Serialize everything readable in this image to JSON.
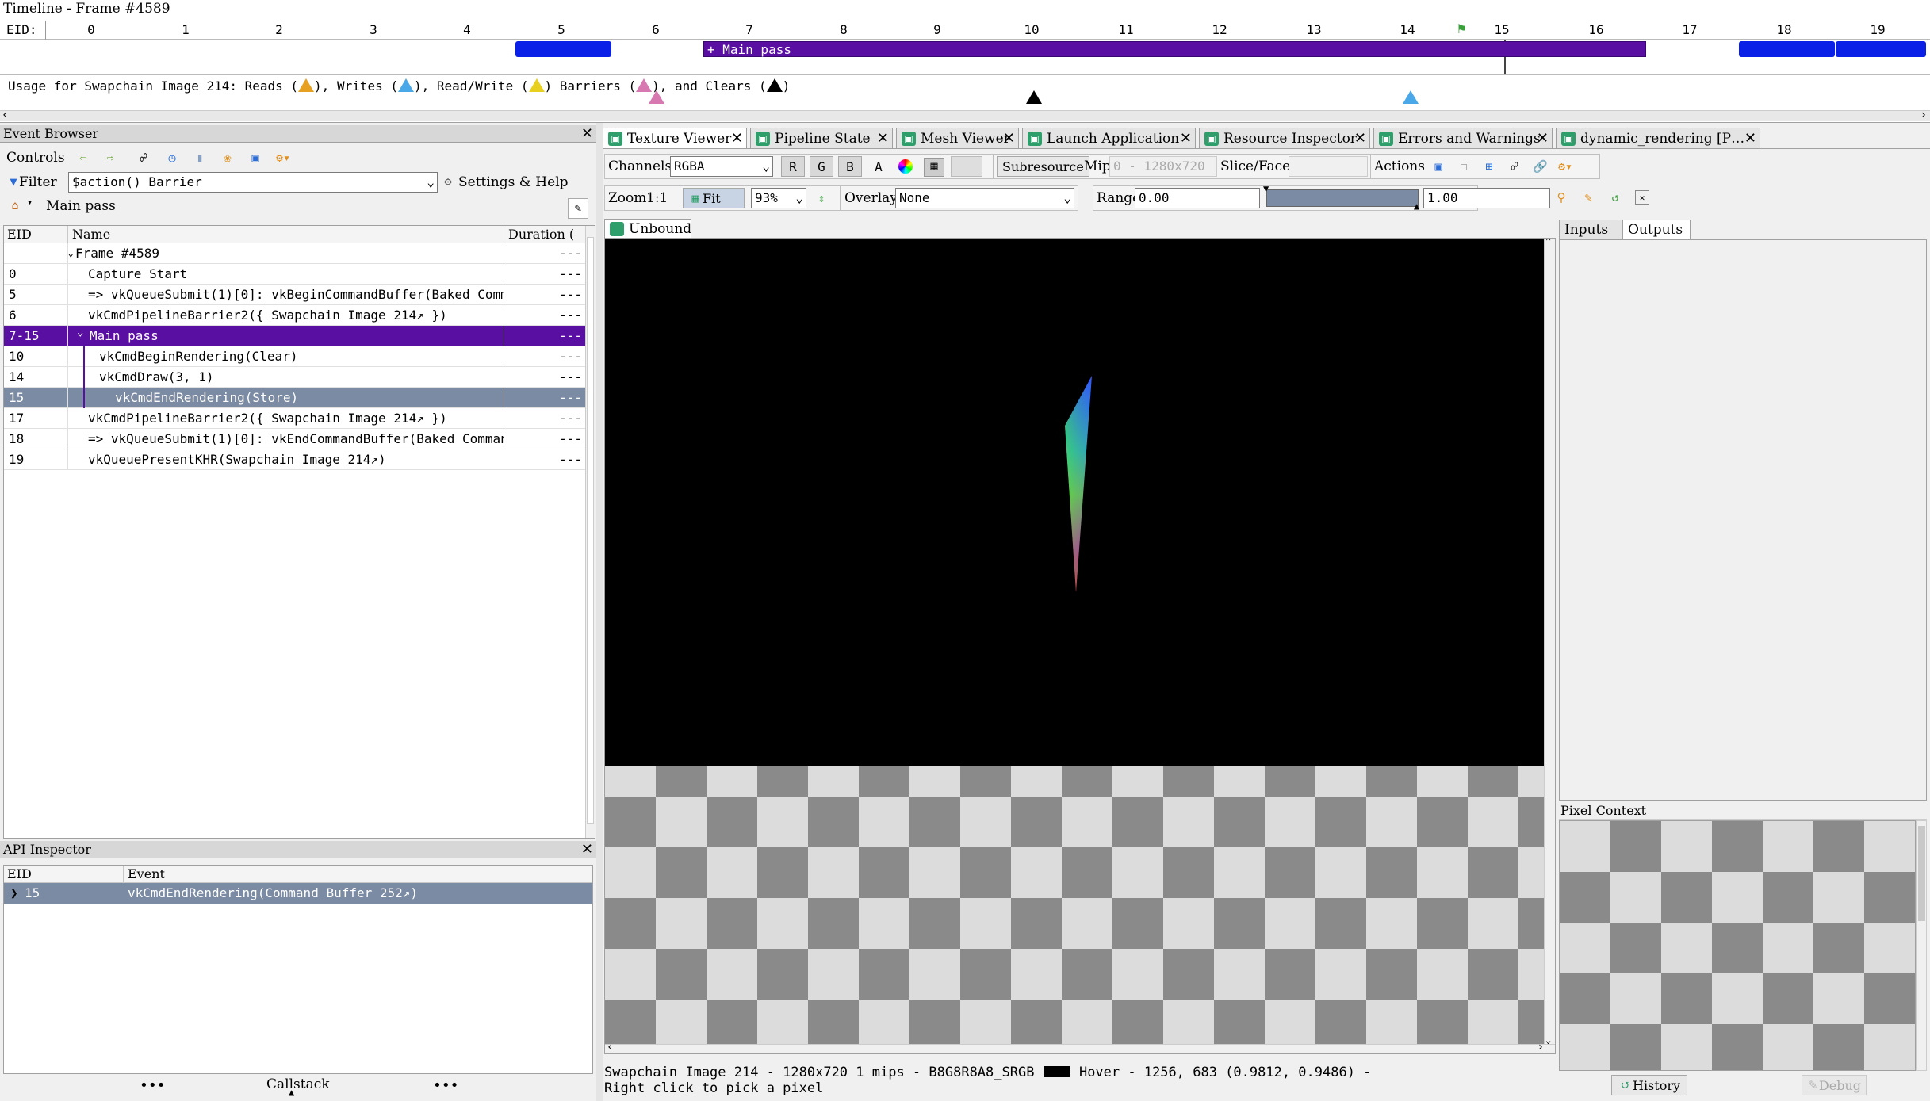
{
  "timeline": {
    "title": "Timeline - Frame #4589",
    "eid_label": "EID:",
    "ticks": [
      "0",
      "1",
      "2",
      "3",
      "4",
      "5",
      "6",
      "7",
      "8",
      "9",
      "10",
      "11",
      "12",
      "13",
      "14",
      "15",
      "16",
      "17",
      "18",
      "19"
    ],
    "main_pass_label": "+ Main pass",
    "usage_text": "Usage for Swapchain Image 214: Reads (",
    "usage_writes": "), Writes (",
    "usage_rw": "), Read/Write (",
    "usage_barriers": ") Barriers (",
    "usage_clears": "), and Clears (",
    "usage_end": ")"
  },
  "event_browser": {
    "title": "Event Browser",
    "controls_label": "Controls",
    "filter_label": "Filter",
    "filter_value": "$action() Barrier",
    "settings_label": "Settings & Help",
    "breadcrumb": "Main pass",
    "columns": {
      "eid": "EID",
      "name": "Name",
      "duration": "Duration ("
    },
    "rows": [
      {
        "eid": "",
        "name": "Frame #4589",
        "dur": "---",
        "style": ""
      },
      {
        "eid": "0",
        "name": "Capture Start",
        "dur": "---",
        "style": ""
      },
      {
        "eid": "5",
        "name": "=>  vkQueueSubmit(1)[0]:  vkBeginCommandBuffer(Baked Comm",
        "dur": "---",
        "style": ""
      },
      {
        "eid": "6",
        "name": "vkCmdPipelineBarrier2({  Swapchain Image 214↗  })",
        "dur": "---",
        "style": ""
      },
      {
        "eid": "7-15",
        "name": "Main pass",
        "dur": "---",
        "style": "sel-purple"
      },
      {
        "eid": "10",
        "name": "vkCmdBeginRendering(Clear)",
        "dur": "---",
        "style": ""
      },
      {
        "eid": "14",
        "name": "vkCmdDraw(3, 1)",
        "dur": "---",
        "style": ""
      },
      {
        "eid": "15",
        "name": "vkCmdEndRendering(Store)",
        "dur": "---",
        "style": "sel-gray"
      },
      {
        "eid": "17",
        "name": "vkCmdPipelineBarrier2({  Swapchain Image 214↗  })",
        "dur": "---",
        "style": ""
      },
      {
        "eid": "18",
        "name": "=>  vkQueueSubmit(1)[0]:  vkEndCommandBuffer(Baked Comman",
        "dur": "---",
        "style": ""
      },
      {
        "eid": "19",
        "name": "vkQueuePresentKHR(Swapchain Image 214↗)",
        "dur": "---",
        "style": ""
      }
    ]
  },
  "api_inspector": {
    "title": "API Inspector",
    "columns": {
      "eid": "EID",
      "event": "Event"
    },
    "row": {
      "eid": "15",
      "event": "vkCmdEndRendering(Command Buffer 252↗)"
    },
    "callstack_label": "Callstack"
  },
  "tabs": [
    {
      "label": "Texture Viewer",
      "active": true
    },
    {
      "label": "Pipeline State",
      "active": false
    },
    {
      "label": "Mesh Viewer",
      "active": false
    },
    {
      "label": "Launch Application",
      "active": false
    },
    {
      "label": "Resource Inspector",
      "active": false
    },
    {
      "label": "Errors and Warnings",
      "active": false
    },
    {
      "label": "dynamic_rendering [P…",
      "active": false
    }
  ],
  "texture_viewer": {
    "channels_label": "Channels",
    "channels_value": "RGBA",
    "r": "R",
    "g": "G",
    "b": "B",
    "a": "A",
    "subresource_label": "Subresource",
    "mip_label": "Mip",
    "mip_value": "0 - 1280x720",
    "slice_label": "Slice/Face",
    "actions_label": "Actions",
    "zoom_label": "Zoom",
    "zoom_1to1": "1:1",
    "fit_label": "Fit",
    "zoom_value": "93%",
    "overlay_label": "Overlay",
    "overlay_value": "None",
    "range_label": "Range",
    "range_min": "0.00",
    "range_max": "1.00",
    "unbound_tab": "Unbound",
    "status_line1": "Swapchain Image 214 - 1280x720 1 mips - B8G8R8A8_SRGB",
    "status_hover": "Hover -  1256,  683 (0.9812, 0.9486)  -",
    "status_line2": "Right click to pick a pixel"
  },
  "right_panel": {
    "inputs_tab": "Inputs",
    "outputs_tab": "Outputs",
    "pixel_context_title": "Pixel Context",
    "history_label": "History",
    "debug_label": "Debug"
  },
  "colors": {
    "accent_purple": "#5a0fa3",
    "bar_blue": "#0a20e6",
    "selection_gray": "#7b8ba3"
  }
}
